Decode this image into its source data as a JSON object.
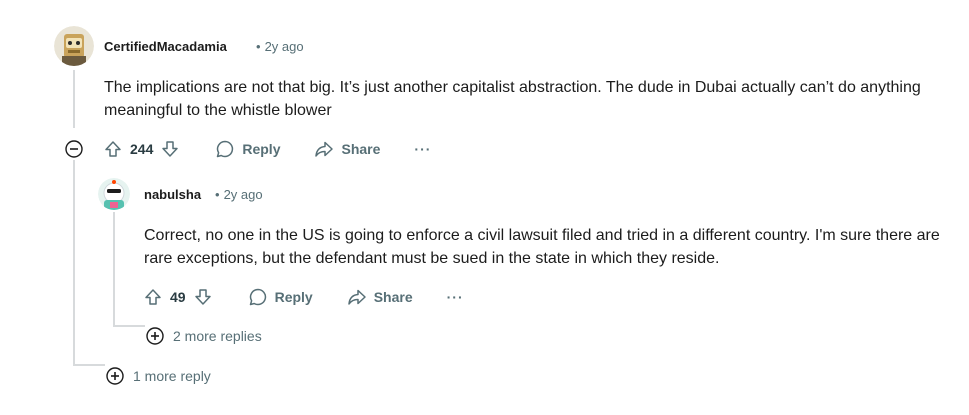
{
  "comment": {
    "username": "CertifiedMacadamia",
    "time": "2y ago",
    "separator": "•",
    "body": "The implications are not that big. It’s just another capitalist abstraction. The dude in Dubai actually can’t do anything meaningful to the whistle blower",
    "votes": "244",
    "reply_label": "Reply",
    "share_label": "Share",
    "more_label": "···",
    "more_replies_label": "1 more reply"
  },
  "reply": {
    "username": "nabulsha",
    "time": "2y ago",
    "separator": "•",
    "body": "Correct, no one in the US is going to enforce a civil lawsuit filed and tried in a different country. I'm sure there are rare exceptions, but the defendant must be sued in the state in which they reside.",
    "votes": "49",
    "reply_label": "Reply",
    "share_label": "Share",
    "more_label": "···",
    "more_replies_label": "2 more replies"
  },
  "colors": {
    "text": "#1c1c1c",
    "meta": "#576f76",
    "thread_line": "#d7dadc"
  },
  "icons": [
    "upvote-icon",
    "downvote-icon",
    "comment-bubble-icon",
    "share-arrow-icon",
    "collapse-minus-icon",
    "expand-plus-icon"
  ]
}
